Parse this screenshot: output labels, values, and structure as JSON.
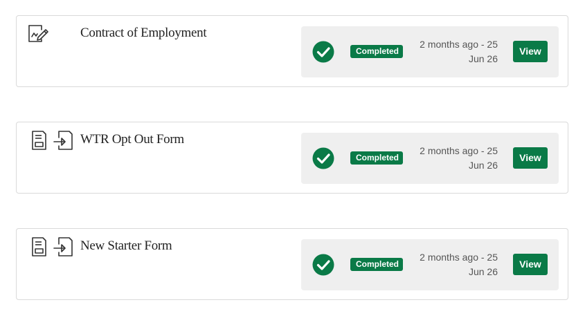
{
  "colors": {
    "accent": "#0a7a47",
    "panel_bg": "#efefef",
    "border": "#d9d9d9"
  },
  "documents": [
    {
      "title": "Contract of Employment",
      "icons": [
        "signature-icon"
      ],
      "status": "Completed",
      "time_line1": "2 months ago - 25",
      "time_line2": "Jun 26",
      "action_label": "View"
    },
    {
      "title": "WTR Opt Out Form",
      "icons": [
        "form-document-icon",
        "form-submit-icon"
      ],
      "status": "Completed",
      "time_line1": "2 months ago - 25",
      "time_line2": "Jun 26",
      "action_label": "View"
    },
    {
      "title": "New Starter Form",
      "icons": [
        "form-document-icon",
        "form-submit-icon"
      ],
      "status": "Completed",
      "time_line1": "2 months ago - 25",
      "time_line2": "Jun 26",
      "action_label": "View"
    }
  ]
}
